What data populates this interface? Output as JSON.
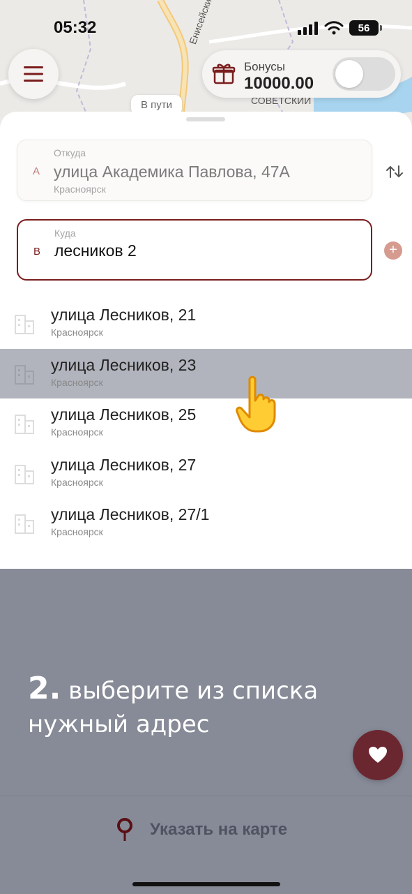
{
  "status_bar": {
    "time": "05:32",
    "battery": "56"
  },
  "map": {
    "street_label": "Енисейский тракт",
    "district_label": "СОВЕТСКИЙ",
    "chip": "В пути"
  },
  "bonus": {
    "label": "Бонусы",
    "value": "10000.00"
  },
  "route": {
    "from": {
      "letter": "A",
      "label": "Откуда",
      "value": "улица Академика Павлова, 47А",
      "city": "Красноярск"
    },
    "to": {
      "letter": "B",
      "label": "Куда",
      "value": "лесников 2"
    }
  },
  "suggestions": [
    {
      "title": "улица Лесников, 21",
      "city": "Красноярск"
    },
    {
      "title": "улица Лесников, 23",
      "city": "Красноярск"
    },
    {
      "title": "улица Лесников, 25",
      "city": "Красноярск"
    },
    {
      "title": "улица Лесников, 27",
      "city": "Красноярск"
    },
    {
      "title": "улица Лесников, 27/1",
      "city": "Красноярск"
    }
  ],
  "instruction": {
    "number": "2.",
    "text": " выберите из списка нужный адрес"
  },
  "bottom": {
    "map_point_label": "Указать на карте"
  },
  "colors": {
    "accent": "#7a1d1d",
    "overlay": "#878b97",
    "highlight": "#b1b4bd"
  },
  "icons": [
    "menu-icon",
    "gift-icon",
    "swap-icon",
    "add-icon",
    "building-icon",
    "heart-icon",
    "pin-icon",
    "pointer-hand-icon"
  ]
}
